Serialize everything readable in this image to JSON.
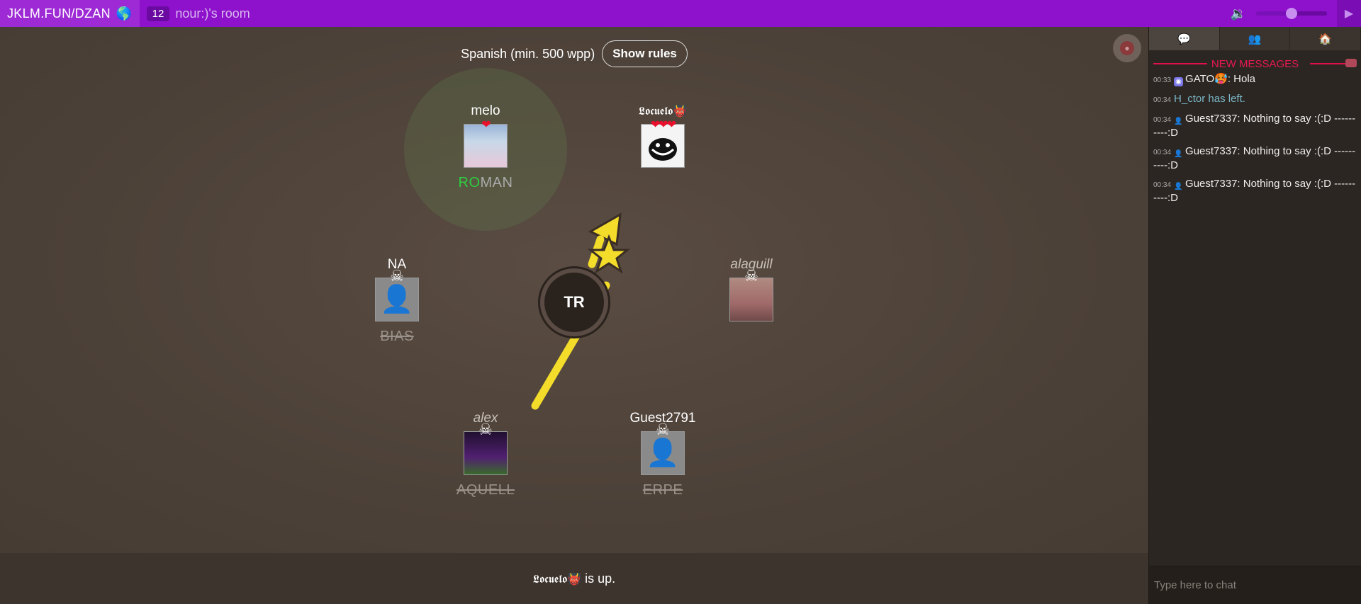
{
  "header": {
    "brand": "JKLM.FUN/DZAN",
    "globe_icon": "🌎",
    "room_count": "12",
    "room_name": "nour:)'s room",
    "volume_icon": "🔉",
    "volume_level": 0.5
  },
  "game": {
    "rules_text": "Spanish (min. 500 wpp)",
    "rules_button": "Show rules",
    "bomb_syllable": "TR",
    "players": [
      {
        "id": "melo",
        "name": "melo",
        "dead": false,
        "hearts": "❤",
        "word_hit": "RO",
        "word_rest": "MAN",
        "struck": false
      },
      {
        "id": "locuelo",
        "name": "𝕷𝖔𝖈𝖚𝖊𝖑𝖔👹",
        "dead": false,
        "hearts": "❤❤❤",
        "word_hit": "",
        "word_rest": "",
        "struck": false
      },
      {
        "id": "na",
        "name": "NA",
        "dead": true,
        "status": "☠",
        "word_hit": "",
        "word_rest": "BIAS",
        "struck": true
      },
      {
        "id": "alaguill",
        "name": "alaguill",
        "dead": true,
        "status": "☠",
        "word_hit": "",
        "word_rest": "",
        "struck": false
      },
      {
        "id": "alex",
        "name": "alex",
        "dead": true,
        "status": "☠",
        "word_hit": "",
        "word_rest": "AQUELL",
        "struck": true
      },
      {
        "id": "guest2791",
        "name": "Guest2791",
        "dead": true,
        "status": "☠",
        "word_hit": "",
        "word_rest": "ERPE",
        "struck": true
      }
    ],
    "turn_name": "𝕷𝖔𝖈𝖚𝖊𝖑𝖔👹",
    "turn_suffix": " is up."
  },
  "sidebar": {
    "tabs": [
      "💬",
      "👥",
      "🏠"
    ],
    "new_messages": "NEW MESSAGES",
    "messages": [
      {
        "time": "00:33",
        "icon": "discord",
        "author": "GATO🥵",
        "text": ": Hola"
      },
      {
        "time": "00:34",
        "icon": "",
        "author": "",
        "text": "H_ctor  has left.",
        "system": true
      },
      {
        "time": "00:34",
        "icon": "guest",
        "author": "Guest7337",
        "text": ": Nothing to say :(:D ----------:D"
      },
      {
        "time": "00:34",
        "icon": "guest",
        "author": "Guest7337",
        "text": ": Nothing to say :(:D ----------:D"
      },
      {
        "time": "00:34",
        "icon": "guest",
        "author": "Guest7337",
        "text": ": Nothing to say :(:D ----------:D"
      }
    ],
    "chat_placeholder": "Type here to chat"
  }
}
